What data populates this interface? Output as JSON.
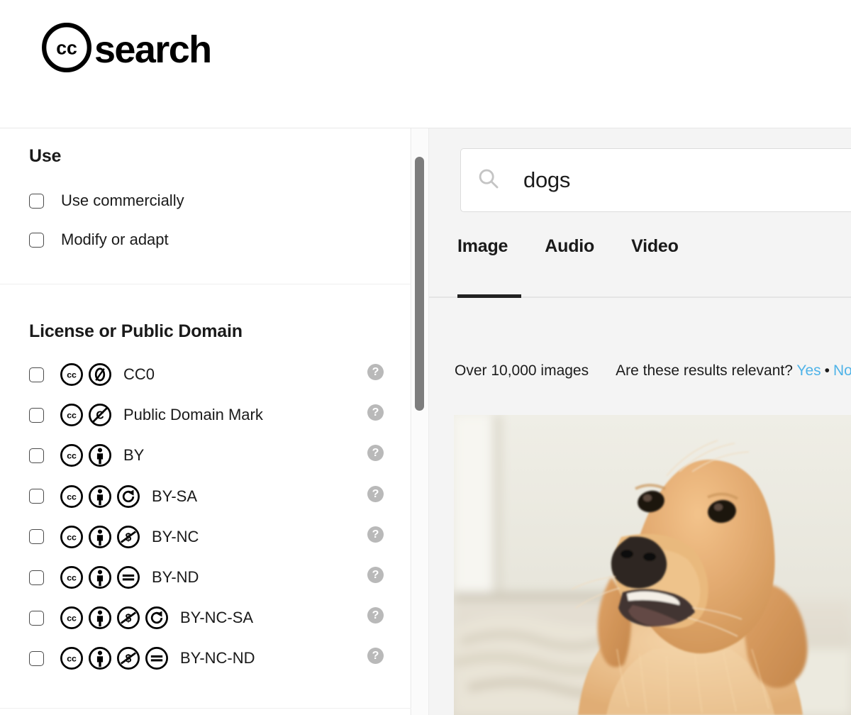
{
  "header": {
    "logo_cc": "cc-logo-icon",
    "logo_text": "search"
  },
  "sidebar": {
    "use": {
      "title": "Use",
      "options": [
        {
          "label": "Use commercially",
          "checked": false
        },
        {
          "label": "Modify or adapt",
          "checked": false
        }
      ]
    },
    "license": {
      "title": "License or Public Domain",
      "help_glyph": "?",
      "options": [
        {
          "label": "CC0",
          "checked": false,
          "icons": [
            "cc",
            "zero"
          ]
        },
        {
          "label": "Public Domain Mark",
          "checked": false,
          "icons": [
            "cc",
            "pd"
          ]
        },
        {
          "label": "BY",
          "checked": false,
          "icons": [
            "cc",
            "by"
          ]
        },
        {
          "label": "BY-SA",
          "checked": false,
          "icons": [
            "cc",
            "by",
            "sa"
          ]
        },
        {
          "label": "BY-NC",
          "checked": false,
          "icons": [
            "cc",
            "by",
            "nc"
          ]
        },
        {
          "label": "BY-ND",
          "checked": false,
          "icons": [
            "cc",
            "by",
            "nd"
          ]
        },
        {
          "label": "BY-NC-SA",
          "checked": false,
          "icons": [
            "cc",
            "by",
            "nc",
            "sa"
          ]
        },
        {
          "label": "BY-NC-ND",
          "checked": false,
          "icons": [
            "cc",
            "by",
            "nc",
            "nd"
          ]
        }
      ]
    }
  },
  "search": {
    "value": "dogs",
    "icon": "search-icon"
  },
  "tabs": [
    {
      "label": "Image",
      "active": true
    },
    {
      "label": "Audio",
      "active": false
    },
    {
      "label": "Video",
      "active": false
    }
  ],
  "results": {
    "count_text": "Over 10,000 images",
    "relevance_question": "Are these results relevant?",
    "relevance_yes": "Yes",
    "relevance_separator": "•",
    "relevance_no": "No",
    "image_alt": "golden retriever dog"
  },
  "colors": {
    "link": "#4fb3e8",
    "panel_bg": "#f4f4f4",
    "text": "#1a1a1a",
    "help_badge": "#b9b9b9",
    "tab_active_underline": "#222222"
  }
}
